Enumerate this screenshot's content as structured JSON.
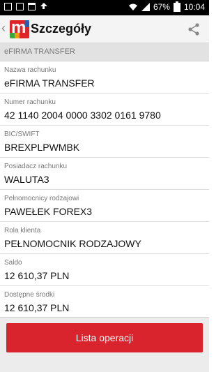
{
  "status_bar": {
    "battery": "67%",
    "time": "10:04"
  },
  "appbar": {
    "title": "Szczegóły",
    "back": "‹"
  },
  "section": {
    "title": "eFIRMA TRANSFER"
  },
  "fields": [
    {
      "label": "Nazwa rachunku",
      "value": "eFIRMA TRANSFER"
    },
    {
      "label": "Numer rachunku",
      "value": "42 1140 2004 0000 3302 0161 9780"
    },
    {
      "label": "BIC/SWIFT",
      "value": "BREXPLPWMBK"
    },
    {
      "label": "Posiadacz rachunku",
      "value": "WALUTA3"
    },
    {
      "label": "Pełnomocnicy rodzajowi",
      "value": "PAWEŁEK FOREX3"
    },
    {
      "label": "Rola klienta",
      "value": "PEŁNOMOCNIK RODZAJOWY"
    },
    {
      "label": "Saldo",
      "value": "12 610,37 PLN"
    },
    {
      "label": "Dostępne środki",
      "value": "12 610,37 PLN"
    }
  ],
  "footer": {
    "button": "Lista operacji"
  },
  "colors": {
    "accent": "#d9232d",
    "header_bg": "#f4f4f4",
    "section_bg": "#e2e2e2"
  }
}
